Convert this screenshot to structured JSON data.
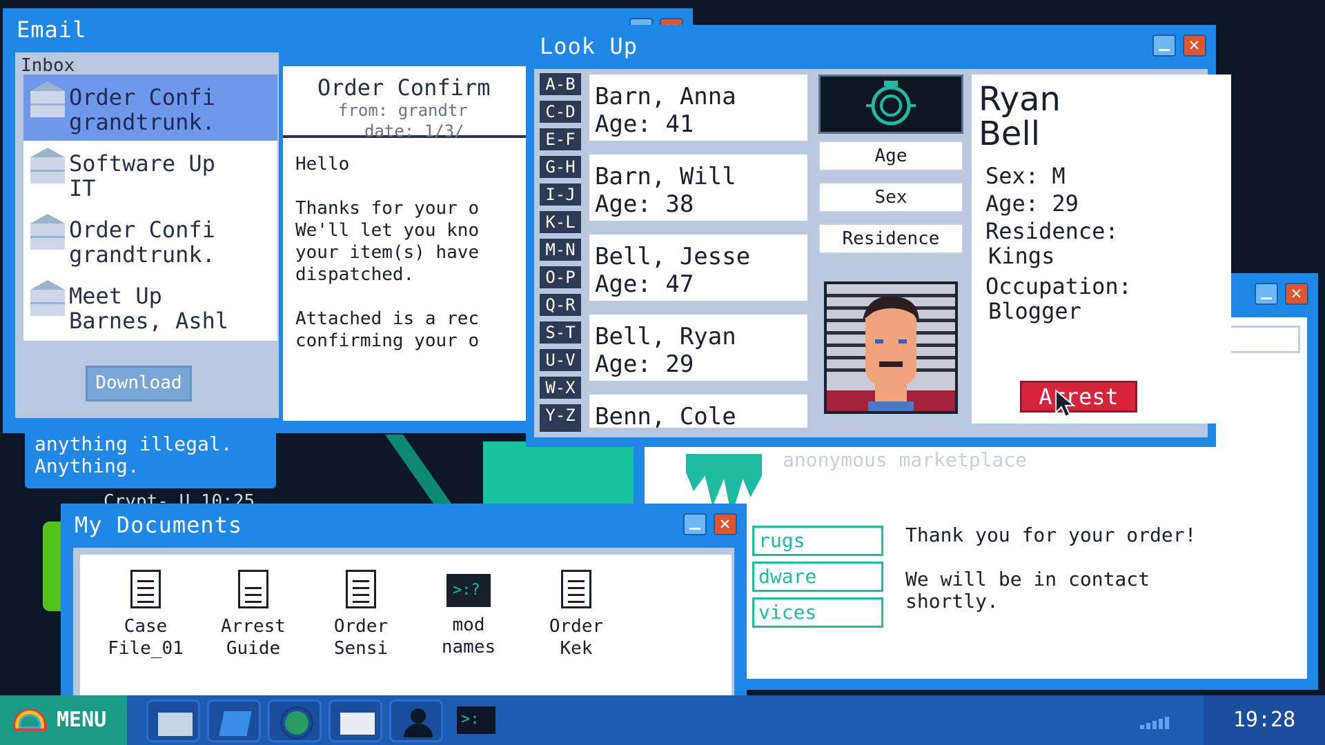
{
  "background": {
    "chat_text": "anything illegal.\nAnything.",
    "chat_time": "Crypt- U 10:25"
  },
  "email": {
    "title": "Email",
    "inbox_label": "Inbox",
    "items": [
      {
        "line1": "Order Confi",
        "line2": "grandtrunk."
      },
      {
        "line1": "Software Up",
        "line2": "IT"
      },
      {
        "line1": "Order Confi",
        "line2": "grandtrunk."
      },
      {
        "line1": "Meet Up",
        "line2": "Barnes, Ashl"
      }
    ],
    "download_label": "Download",
    "message": {
      "subject": "Order Confirm",
      "from": "from:  grandtr",
      "date": "date:  1/3/",
      "body": "Hello\n\nThanks for your o\nWe'll let you kno\nyour item(s) have\ndispatched.\n\nAttached is a rec\nconfirming your o"
    }
  },
  "lookup": {
    "title": "Look Up",
    "letters": [
      "A-B",
      "C-D",
      "E-F",
      "G-H",
      "I-J",
      "K-L",
      "M-N",
      "O-P",
      "Q-R",
      "S-T",
      "U-V",
      "W-X",
      "Y-Z"
    ],
    "people": [
      {
        "name": "Barn, Anna",
        "age": "Age: 41"
      },
      {
        "name": "Barn, Will",
        "age": "Age: 38"
      },
      {
        "name": "Bell, Jesse",
        "age": "Age: 47"
      },
      {
        "name": "Bell, Ryan",
        "age": "Age: 29"
      },
      {
        "name": "Benn, Cole",
        "age": ""
      }
    ],
    "sort_buttons": [
      "Age",
      "Sex",
      "Residence"
    ],
    "selected": {
      "first_name": "Ryan",
      "last_name": "Bell",
      "sex": "Sex: M",
      "age": "Age: 29",
      "residence_label": "Residence:",
      "residence": "Kings",
      "occupation_label": "Occupation:",
      "occupation": "Blogger"
    },
    "arrest_label": "Arrest"
  },
  "marketplace": {
    "faint_text": "anonymous marketplace",
    "tabs": [
      "rugs",
      "dware",
      "vices"
    ],
    "thank_you": "Thank you for your order!\n\nWe will be in contact\nshortly."
  },
  "documents": {
    "title": "My Documents",
    "files": [
      {
        "name": "Case\nFile_01",
        "icon": "document-icon"
      },
      {
        "name": "Arrest\nGuide",
        "icon": "page-icon"
      },
      {
        "name": "Order\nSensi",
        "icon": "document-icon"
      },
      {
        "name": "mod\nnames",
        "icon": "terminal-icon"
      },
      {
        "name": "Order\nKek",
        "icon": "document-icon"
      }
    ]
  },
  "taskbar": {
    "menu_label": "MENU",
    "apps": [
      "folder-icon",
      "note-icon",
      "globe-icon",
      "mail-icon",
      "person-icon",
      "terminal-icon"
    ],
    "time": "19:28"
  },
  "colors": {
    "window_blue": "#1f87e6",
    "accent_teal": "#1fbba0",
    "arrest_red": "#d6243a",
    "selection_blue": "#6f98ea"
  }
}
